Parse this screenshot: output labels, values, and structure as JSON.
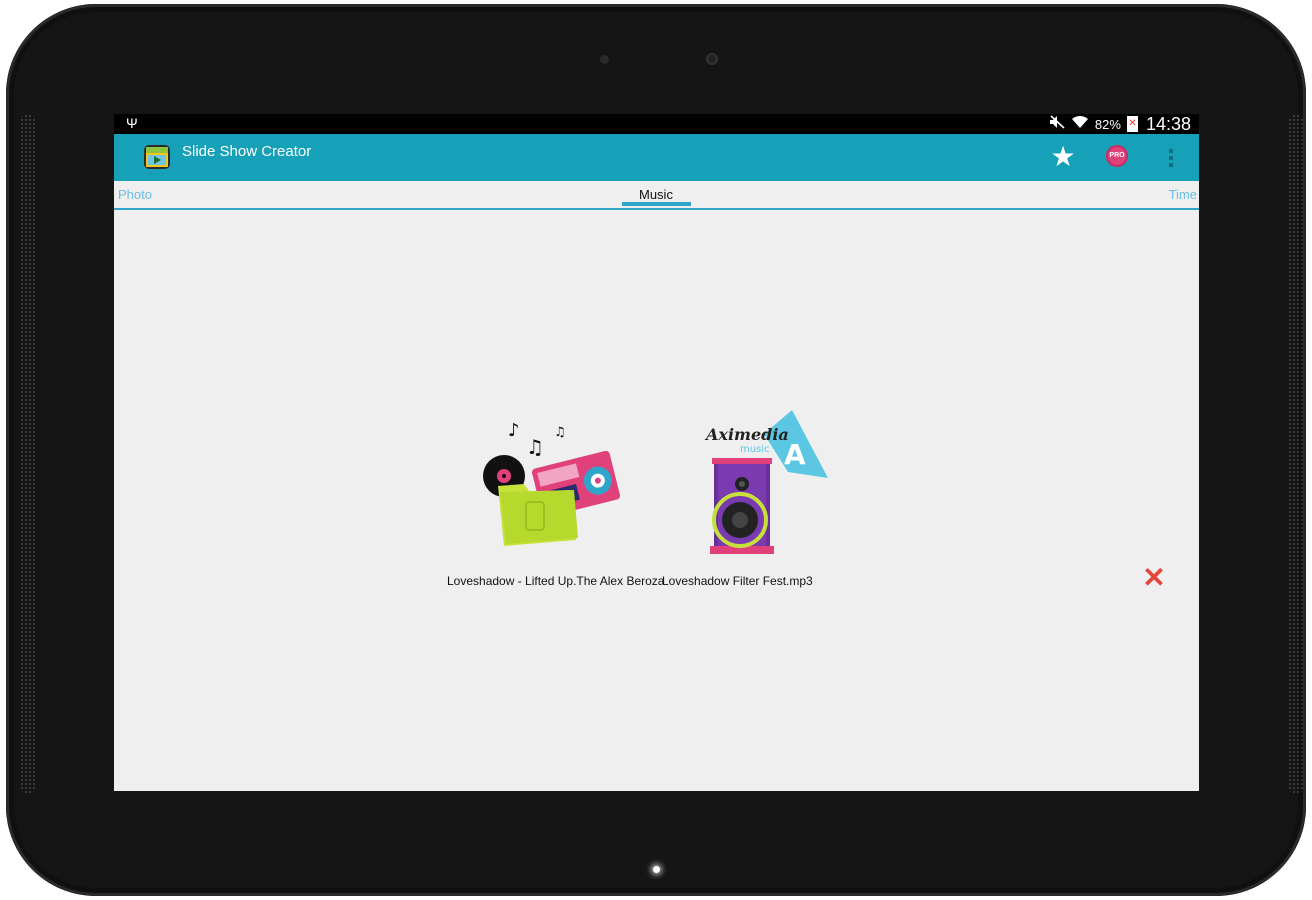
{
  "status_bar": {
    "battery_percent": "82%",
    "time": "14:38"
  },
  "app_bar": {
    "title": "Slide Show Creator",
    "pro_badge": "PRO"
  },
  "tabs": [
    {
      "label": "Photo",
      "selected": false
    },
    {
      "label": "Music",
      "selected": true
    },
    {
      "label": "Time",
      "selected": false
    }
  ],
  "music_items": [
    {
      "label": "Loveshadow - Lifted Up.The Alex Beroza",
      "icon": "music-folder-icon"
    },
    {
      "label": "Loveshadow Filter Fest.mp3",
      "icon": "aximedia-speaker-icon",
      "logo_text": "Aximedia",
      "logo_subtext": "music"
    }
  ],
  "colors": {
    "action_bar": "#17a1b8",
    "tab_accent": "#2fa5c9",
    "close": "#e2463a"
  }
}
